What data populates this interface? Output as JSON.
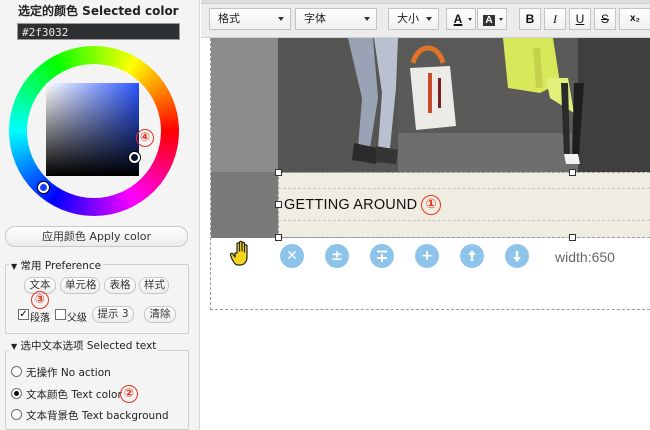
{
  "color_panel": {
    "title": "选定的颜色 Selected color",
    "hex_value": "#2f3032",
    "apply_label": "应用颜色 Apply color",
    "marker_4": "④"
  },
  "preference": {
    "legend": "常用 Preference",
    "buttons": [
      "文本",
      "单元格",
      "表格",
      "样式"
    ],
    "marker_3": "③",
    "checkbox_paragraph": "段落",
    "checkbox_parent": "父级",
    "hint_label": "提示 3",
    "clear_label": "清除"
  },
  "selected_text": {
    "legend": "选中文本选项 Selected text",
    "options": [
      "无操作 No action",
      "文本颜色 Text color",
      "文本背景色 Text background"
    ],
    "selected_index": 1,
    "marker_2": "②"
  },
  "toolbar": {
    "format_label": "格式",
    "font_label": "字体",
    "size_label": "大小",
    "text_color_glyph": "A",
    "bg_color_glyph": "A",
    "bold": "B",
    "italic": "I",
    "underline": "U",
    "strike": "S",
    "subscript": "x₂"
  },
  "editor": {
    "cell_text": "GETTING AROUND",
    "marker_1": "①",
    "width_label": "width:650"
  },
  "colors": {
    "selected": "#2f3032",
    "cell_bg": "#efece2",
    "action_btn": "#8fc4ea",
    "marker_red": "#e8331e"
  },
  "icons": [
    "hand-icon",
    "close-circle-icon",
    "plus-minus-circle-icon",
    "insert-above-icon",
    "add-circle-icon",
    "arrow-up-circle-icon",
    "arrow-down-circle-icon"
  ]
}
